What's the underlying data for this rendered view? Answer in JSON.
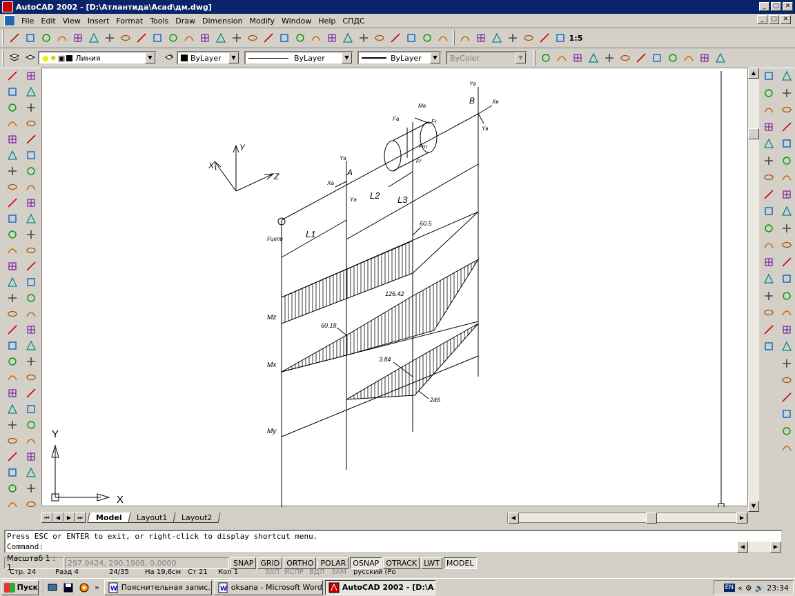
{
  "window": {
    "title": "AutoCAD 2002 - [D:\\Атлантида\\Acad\\дм.dwg]",
    "controls": [
      "_",
      "□",
      "✕"
    ]
  },
  "menu": {
    "items": [
      "File",
      "Edit",
      "View",
      "Insert",
      "Format",
      "Tools",
      "Draw",
      "Dimension",
      "Modify",
      "Window",
      "Help",
      "СПДС"
    ]
  },
  "toolbar_standard": {
    "icons": [
      "new-icon",
      "open-icon",
      "save-icon",
      "print-icon",
      "preview-icon",
      "find-icon",
      "cut-icon",
      "copy-icon",
      "paste-icon",
      "match-icon",
      "undo-icon",
      "redo-icon",
      "today-icon",
      "browser-icon",
      "dbconnect-icon",
      "hyperlink-icon",
      "snap-from-icon",
      "ucs-icon",
      "namedview-icon",
      "tree-icon",
      "pan-icon",
      "zoom-realtime-icon",
      "zoom-window-icon",
      "zoom-prev-icon",
      "properties-icon",
      "designcenter-icon",
      "help-icon",
      "misc-icon"
    ]
  },
  "toolbar_right1": {
    "icons": [
      "dim-linear-icon",
      "dim-aligned-icon",
      "dim-ordinate-icon",
      "leader-icon",
      "tolerance-icon",
      "dim-edit-icon",
      "text-style-icon"
    ],
    "scale_label": "1:5"
  },
  "layers": {
    "layer_name": "Линия",
    "color": "ByLayer",
    "linetype": "ByLayer",
    "lineweight": "ByLayer",
    "plotstyle": "ByColor"
  },
  "left_toolbar_draw": {
    "icons": [
      "line-icon",
      "construction-line-icon",
      "multiline-icon",
      "polyline-icon",
      "polygon-icon",
      "rectangle-icon",
      "arc-icon",
      "circle-icon",
      "spline-icon",
      "ellipse-icon",
      "revcloud-icon",
      "insert-block-icon",
      "make-block-icon",
      "point-icon",
      "hatch-icon",
      "region-icon",
      "multiline-text-icon",
      "layer-icon",
      "xline-icon",
      "boundary-icon",
      "measure-icon",
      "edit-polyline-icon",
      "pedit-icon",
      "sketch-icon",
      "wipeout-icon",
      "donut-icon",
      "solid-icon",
      "trace-icon",
      "donut2-icon",
      "table-icon"
    ]
  },
  "left_toolbar_modify": {
    "icons": [
      "erase-icon",
      "copy-object-icon",
      "mirror-icon",
      "offset-icon",
      "array-icon",
      "move-icon",
      "rotate-icon",
      "scale-icon",
      "stretch-icon",
      "lengthen-icon",
      "trim-icon",
      "extend-icon",
      "break-icon",
      "chamfer-icon",
      "fillet-icon",
      "explode-icon",
      "join-icon",
      "divide-icon",
      "align-icon",
      "wblock-icon",
      "regen-icon",
      "group-icon",
      "order-icon",
      "properties2-icon",
      "purge-icon",
      "layout-icon",
      "text-icon",
      "insert2-icon"
    ]
  },
  "right_toolbar_dim": {
    "icons": [
      "dim-linear2-icon",
      "dim-aligned2-icon",
      "dim-ordinate2-icon",
      "dim-radius-icon",
      "dim-diameter-icon",
      "dim-angular-icon",
      "quick-dim-icon",
      "dim-baseline-icon",
      "dim-continue-icon",
      "leader2-icon",
      "tolerance2-icon",
      "center-mark-icon",
      "dim-edit2-icon",
      "dim-textedit-icon",
      "dim-update-icon",
      "dim-style-icon",
      "dim-override-icon"
    ]
  },
  "right_toolbar_osnap": {
    "icons": [
      "osnap-temp-icon",
      "osnap-from-icon",
      "osnap-endpoint-icon",
      "osnap-midpoint-icon",
      "osnap-intersect-icon",
      "osnap-apparent-icon",
      "osnap-extension-icon",
      "osnap-center-icon",
      "osnap-quadrant-icon",
      "osnap-tangent-icon",
      "osnap-perpendicular-icon",
      "osnap-parallel-icon",
      "osnap-insert-icon",
      "osnap-node-icon",
      "osnap-nearest-icon",
      "osnap-none-icon",
      "osnap-settings-icon",
      "magnet-icon",
      "zoom-icon",
      "ucs-world-icon",
      "ucs-x-icon",
      "ucs-z-icon",
      "snap-icon"
    ]
  },
  "drawing": {
    "axis_labels": {
      "X": "X",
      "Y": "Y",
      "Z": "Z"
    },
    "ucs": {
      "x": "X",
      "y": "Y"
    },
    "points": {
      "A": "A",
      "B": "B"
    },
    "lengths": {
      "l1": "L1",
      "l2": "L2",
      "l3": "L3"
    },
    "forces": {
      "fchain": "Fцепи",
      "ft": "Fт",
      "fr": "Fr",
      "fa": "Fa",
      "ma": "Ma"
    },
    "moments": {
      "mz": "Mz",
      "mx": "Mx",
      "my": "My"
    },
    "reactions": {
      "ya": "Yа",
      "xa": "Xа",
      "yb": "Yв",
      "xb": "Xв",
      "yb2": "Yв"
    },
    "values": {
      "v605": "60.5",
      "v12642": "126.42",
      "v6018": "60.18",
      "v384": "3.84",
      "v246": "246"
    }
  },
  "tabs": {
    "items": [
      "Model",
      "Layout1",
      "Layout2"
    ],
    "active": "Model"
  },
  "command": {
    "line1": "Press ESC or ENTER to exit, or right-click to display shortcut menu.",
    "line2": "Command:"
  },
  "status": {
    "scale": "Масштаб 1 : 1",
    "coords": "297.9424, 290.1908, 0.0000",
    "buttons": [
      "SNAP",
      "GRID",
      "ORTHO",
      "POLAR",
      "OSNAP",
      "OTRACK",
      "LWT",
      "MODEL"
    ],
    "on": [
      "OSNAP",
      "MODEL"
    ]
  },
  "word_status": {
    "page": "Стр. 24",
    "section": "Разд 4",
    "pages": "24/35",
    "pos": "На 19,6см",
    "line": "Ст 21",
    "col": "Кол 1",
    "rec": "ЗАП",
    "trk": "ИСПР",
    "ext": "ВДЛ",
    "ovr": "ЗАМ",
    "lang": "русский (Ро"
  },
  "taskbar": {
    "start": "Пуск",
    "tasks": [
      {
        "label": "Пояснительная запис...",
        "icon": "word-icon"
      },
      {
        "label": "oksana - Microsoft Word",
        "icon": "word-icon"
      },
      {
        "label": "AutoCAD 2002 - [D:\\A...",
        "icon": "autocad-icon"
      }
    ],
    "lang": "EN",
    "time": "23:34"
  }
}
